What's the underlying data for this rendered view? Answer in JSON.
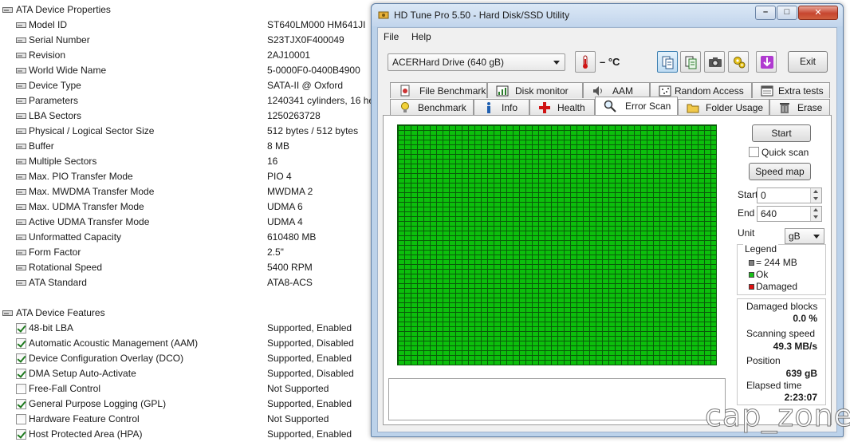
{
  "properties_panel": {
    "section_title": "ATA Device Properties",
    "rows": [
      {
        "label": "Model ID",
        "value": "ST640LM000 HM641JI"
      },
      {
        "label": "Serial Number",
        "value": "S23TJX0F400049"
      },
      {
        "label": "Revision",
        "value": "2AJ10001"
      },
      {
        "label": "World Wide Name",
        "value": "5-0000F0-0400B4900"
      },
      {
        "label": "Device Type",
        "value": "SATA-II @ Oxford"
      },
      {
        "label": "Parameters",
        "value": "1240341 cylinders, 16 hea"
      },
      {
        "label": "LBA Sectors",
        "value": "1250263728"
      },
      {
        "label": "Physical / Logical Sector Size",
        "value": "512 bytes / 512 bytes"
      },
      {
        "label": "Buffer",
        "value": "8 MB"
      },
      {
        "label": "Multiple Sectors",
        "value": "16"
      },
      {
        "label": "Max. PIO Transfer Mode",
        "value": "PIO 4"
      },
      {
        "label": "Max. MWDMA Transfer Mode",
        "value": "MWDMA 2"
      },
      {
        "label": "Max. UDMA Transfer Mode",
        "value": "UDMA 6"
      },
      {
        "label": "Active UDMA Transfer Mode",
        "value": "UDMA 4"
      },
      {
        "label": "Unformatted Capacity",
        "value": "610480 MB"
      },
      {
        "label": "Form Factor",
        "value": "2.5\""
      },
      {
        "label": "Rotational Speed",
        "value": "5400 RPM"
      },
      {
        "label": "ATA Standard",
        "value": "ATA8-ACS"
      }
    ]
  },
  "features_panel": {
    "section_title": "ATA Device Features",
    "rows": [
      {
        "label": "48-bit LBA",
        "value": "Supported, Enabled",
        "checked": true
      },
      {
        "label": "Automatic Acoustic Management (AAM)",
        "value": "Supported, Disabled",
        "checked": true
      },
      {
        "label": "Device Configuration Overlay (DCO)",
        "value": "Supported, Enabled",
        "checked": true
      },
      {
        "label": "DMA Setup Auto-Activate",
        "value": "Supported, Disabled",
        "checked": true
      },
      {
        "label": "Free-Fall Control",
        "value": "Not Supported",
        "checked": false
      },
      {
        "label": "General Purpose Logging (GPL)",
        "value": "Supported, Enabled",
        "checked": true
      },
      {
        "label": "Hardware Feature Control",
        "value": "Not Supported",
        "checked": false
      },
      {
        "label": "Host Protected Area (HPA)",
        "value": "Supported, Enabled",
        "checked": true
      }
    ]
  },
  "window": {
    "title": "HD Tune Pro 5.50 - Hard Disk/SSD Utility",
    "caption_buttons": {
      "minimize": "–",
      "maximize": "□",
      "close": "✕"
    },
    "menu": [
      "File",
      "Help"
    ],
    "drive_select": "ACERHard Drive (640 gB)",
    "temperature": "– °C",
    "exit_label": "Exit",
    "toolbar_icons": [
      "copy-text-icon",
      "copy-all-icon",
      "screenshot-icon",
      "options-icon",
      "save-icon"
    ],
    "tabs_row1": [
      {
        "label": "File Benchmark",
        "icon": "file-benchmark-icon"
      },
      {
        "label": "Disk monitor",
        "icon": "disk-monitor-icon"
      },
      {
        "label": "AAM",
        "icon": "speaker-icon"
      },
      {
        "label": "Random Access",
        "icon": "random-access-icon"
      },
      {
        "label": "Extra tests",
        "icon": "extra-tests-icon"
      }
    ],
    "tabs_row2": [
      {
        "label": "Benchmark",
        "icon": "benchmark-icon"
      },
      {
        "label": "Info",
        "icon": "info-icon"
      },
      {
        "label": "Health",
        "icon": "health-icon"
      },
      {
        "label": "Error Scan",
        "icon": "magnifier-icon",
        "active": true
      },
      {
        "label": "Folder Usage",
        "icon": "folder-icon"
      },
      {
        "label": "Erase",
        "icon": "trash-icon"
      }
    ]
  },
  "error_scan": {
    "start_button": "Start",
    "quick_scan_label": "Quick scan",
    "quick_scan_checked": false,
    "speed_map_button": "Speed map",
    "start_label": "Start",
    "start_value": "0",
    "end_label": "End",
    "end_value": "640",
    "unit_label": "Unit",
    "unit_value": "gB",
    "legend": {
      "title": "Legend",
      "items": [
        {
          "label": "= 244 MB",
          "color": "#808080"
        },
        {
          "label": "Ok",
          "color": "#18c018"
        },
        {
          "label": "Damaged",
          "color": "#e01010"
        }
      ]
    },
    "stats": {
      "damaged_label": "Damaged blocks",
      "damaged_value": "0.0 %",
      "speed_label": "Scanning speed",
      "speed_value": "49.3 MB/s",
      "position_label": "Position",
      "position_value": "639 gB",
      "elapsed_label": "Elapsed time",
      "elapsed_value": "2:23:07"
    },
    "map_ok_color": "#0cbf0c",
    "map_grid_color": "#0a5a0a"
  },
  "watermark": "cap_zone"
}
